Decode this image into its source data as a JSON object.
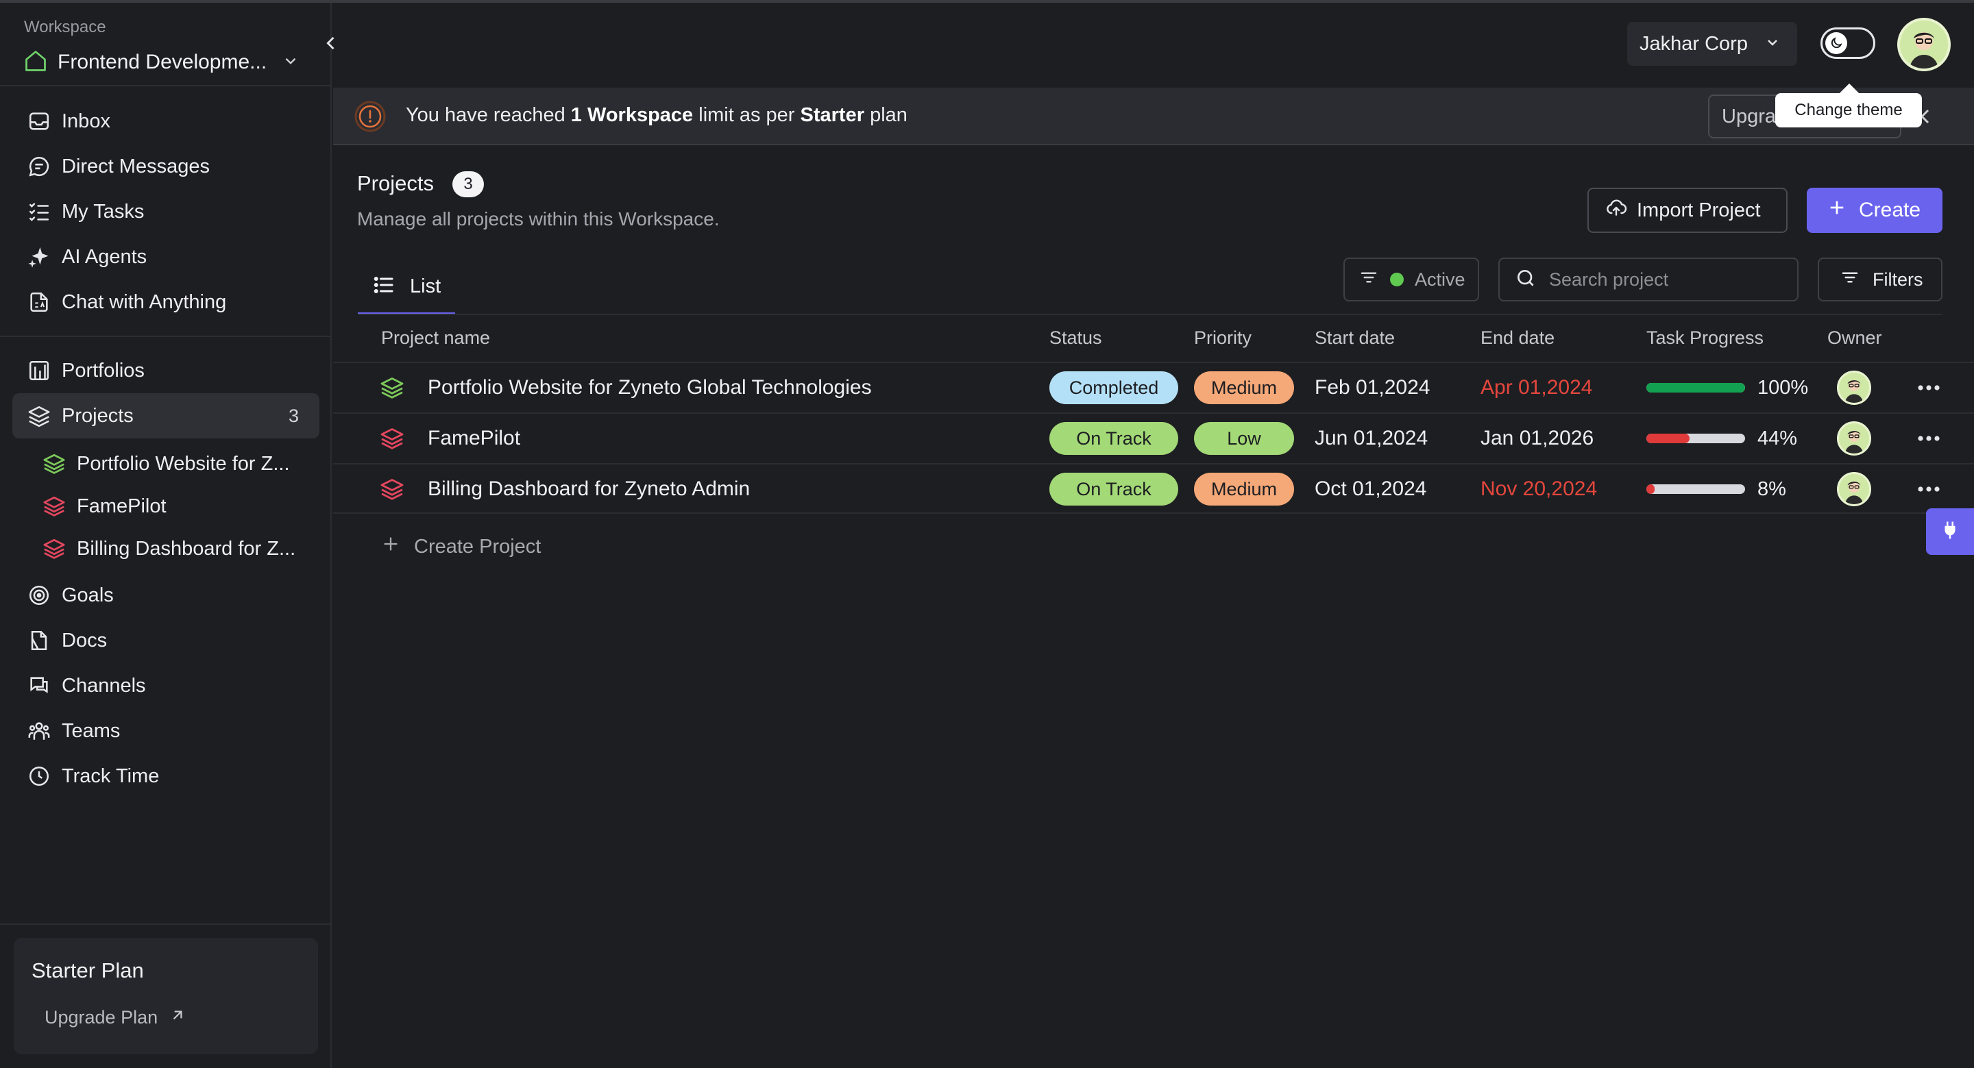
{
  "workspace": {
    "caption": "Workspace",
    "name": "Frontend Developme..."
  },
  "sidebar": {
    "primary": [
      {
        "label": "Inbox",
        "icon": "inbox-icon"
      },
      {
        "label": "Direct Messages",
        "icon": "chat-bubble-icon"
      },
      {
        "label": "My Tasks",
        "icon": "checklist-icon"
      },
      {
        "label": "AI Agents",
        "icon": "sparkle-icon"
      },
      {
        "label": "Chat with Anything",
        "icon": "document-ai-icon"
      }
    ],
    "secondary": [
      {
        "label": "Portfolios",
        "icon": "portfolio-icon"
      },
      {
        "label": "Projects",
        "icon": "layers-icon",
        "count": "3"
      }
    ],
    "projects": [
      {
        "label": "Portfolio Website for Z...",
        "color": "#7cc95a"
      },
      {
        "label": "FamePilot",
        "color": "#e5475f"
      },
      {
        "label": "Billing Dashboard for Z...",
        "color": "#e5475f"
      }
    ],
    "tertiary": [
      {
        "label": "Goals",
        "icon": "target-icon"
      },
      {
        "label": "Docs",
        "icon": "docs-icon"
      },
      {
        "label": "Channels",
        "icon": "channels-icon"
      },
      {
        "label": "Teams",
        "icon": "teams-icon"
      },
      {
        "label": "Track Time",
        "icon": "clock-icon"
      }
    ],
    "plan": {
      "title": "Starter Plan",
      "link": "Upgrade Plan"
    }
  },
  "topbar": {
    "org": "Jakhar Corp",
    "tooltip": "Change theme"
  },
  "banner": {
    "prefix": "You have reached ",
    "bold1": "1 Workspace",
    "middle": " limit as per ",
    "bold2": "Starter",
    "suffix": " plan",
    "upgrade": "Upgrade"
  },
  "page": {
    "title": "Projects",
    "count": "3",
    "subtitle": "Manage all projects within this Workspace.",
    "import": "Import Project",
    "create": "Create",
    "tab": "List",
    "status_filter": "Active",
    "search_placeholder": "Search project",
    "filters": "Filters",
    "create_project": "Create Project"
  },
  "table": {
    "headers": {
      "name": "Project name",
      "status": "Status",
      "priority": "Priority",
      "start": "Start date",
      "end": "End date",
      "progress": "Task Progress",
      "owner": "Owner"
    },
    "rows": [
      {
        "name": "Portfolio Website for Zyneto Global Technologies",
        "icon_color": "#7cc95a",
        "status": "Completed",
        "status_color": "#b4e0f7",
        "priority": "Medium",
        "priority_color": "#f5a878",
        "start": "Feb 01,2024",
        "end": "Apr 01,2024",
        "end_overdue": true,
        "progress": 1.0,
        "progress_label": "100%",
        "progress_color": "#12a150"
      },
      {
        "name": "FamePilot",
        "icon_color": "#e5475f",
        "status": "On Track",
        "status_color": "#a3d977",
        "priority": "Low",
        "priority_color": "#a3d977",
        "start": "Jun 01,2024",
        "end": "Jan 01,2026",
        "end_overdue": false,
        "progress": 0.44,
        "progress_label": "44%",
        "progress_color": "#e03a3a"
      },
      {
        "name": "Billing Dashboard for Zyneto Admin",
        "icon_color": "#e5475f",
        "status": "On Track",
        "status_color": "#a3d977",
        "priority": "Medium",
        "priority_color": "#f5a878",
        "start": "Oct 01,2024",
        "end": "Nov 20,2024",
        "end_overdue": true,
        "progress": 0.08,
        "progress_label": "8%",
        "progress_color": "#e03a3a"
      }
    ]
  }
}
